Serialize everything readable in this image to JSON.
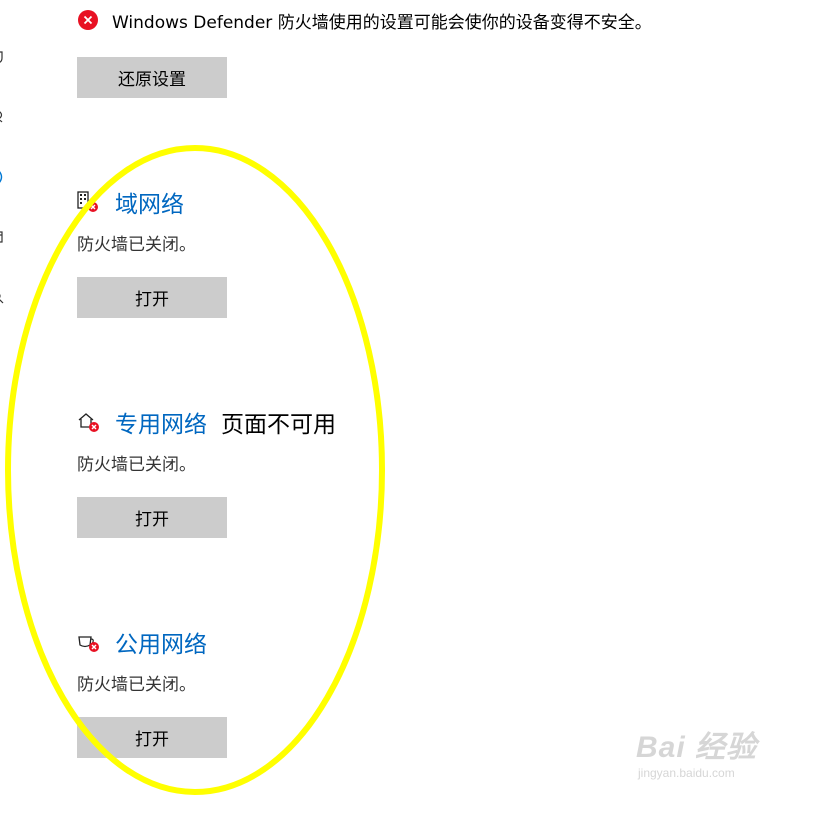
{
  "warning": {
    "icon": "error-icon",
    "message": "Windows Defender 防火墙使用的设置可能会使你的设备变得不安全。"
  },
  "restore_button_label": "还原设置",
  "networks": [
    {
      "icon": "domain-network-icon",
      "name": "域网络",
      "status": "防火墙已关闭。",
      "button_label": "打开"
    },
    {
      "icon": "private-network-icon",
      "name": "专用网络",
      "note": "页面不可用",
      "status": "防火墙已关闭。",
      "button_label": "打开"
    },
    {
      "icon": "public-network-icon",
      "name": "公用网络",
      "status": "防火墙已关闭。",
      "button_label": "打开"
    }
  ],
  "watermark": {
    "main": "Bai 经验",
    "sub": "jingyan.baidu.com"
  },
  "colors": {
    "link": "#0067c0",
    "button_bg": "#cccccc",
    "error": "#e81123",
    "highlight": "#ffff00"
  }
}
